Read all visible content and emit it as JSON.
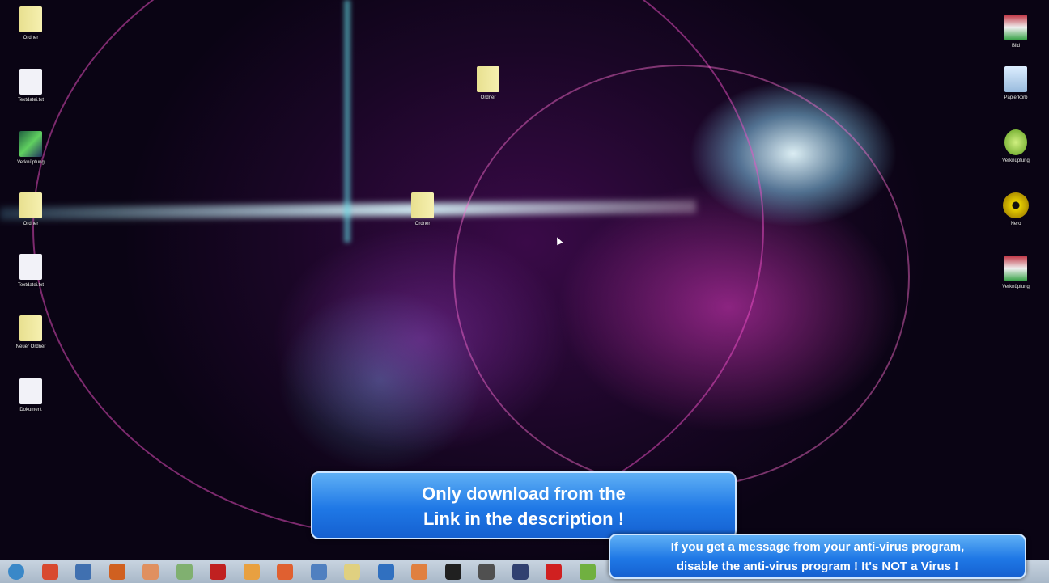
{
  "desktop": {
    "left_icons": [
      {
        "type": "folder",
        "label": "Ordner"
      },
      {
        "type": "doc",
        "label": "Textdatei.txt"
      },
      {
        "type": "net",
        "label": "Verknüpfung"
      },
      {
        "type": "folder",
        "label": "Ordner"
      },
      {
        "type": "doc",
        "label": "Textdatei.txt"
      },
      {
        "type": "folder",
        "label": "Neuer Ordner"
      },
      {
        "type": "doc",
        "label": "Dokument"
      }
    ],
    "center_icons": [
      {
        "type": "folder",
        "label": "Ordner"
      },
      {
        "type": "folder",
        "label": "Ordner"
      }
    ],
    "right_icons": [
      {
        "type": "img",
        "label": "Bild"
      },
      {
        "type": "bin",
        "label": "Papierkorb"
      },
      {
        "type": "globe",
        "label": "Verknüpfung"
      },
      {
        "type": "disc",
        "label": "Nero"
      },
      {
        "type": "img",
        "label": "Verknüpfung"
      }
    ]
  },
  "taskbar": {
    "items": [
      {
        "name": "start-button",
        "color": "#3a88c8"
      },
      {
        "name": "chrome",
        "color": "#d84a30"
      },
      {
        "name": "app",
        "color": "#4070b0"
      },
      {
        "name": "firefox",
        "color": "#d06020"
      },
      {
        "name": "app",
        "color": "#e09060"
      },
      {
        "name": "app",
        "color": "#80b070"
      },
      {
        "name": "filezilla",
        "color": "#c02020"
      },
      {
        "name": "app",
        "color": "#e8a040"
      },
      {
        "name": "app",
        "color": "#e06030"
      },
      {
        "name": "app",
        "color": "#5080c0"
      },
      {
        "name": "app",
        "color": "#e0d080"
      },
      {
        "name": "app",
        "color": "#3070c0"
      },
      {
        "name": "app",
        "color": "#e08040"
      },
      {
        "name": "app",
        "color": "#202020"
      },
      {
        "name": "app",
        "color": "#505050"
      },
      {
        "name": "app",
        "color": "#304070"
      },
      {
        "name": "app",
        "color": "#d02020"
      },
      {
        "name": "app",
        "color": "#70b040"
      }
    ]
  },
  "banners": {
    "main_line1": "Only download from the",
    "main_line2": "Link in the description !",
    "notice_line1": "If you get a message from your anti-virus program,",
    "notice_line2": "disable the anti-virus program ! It's NOT a Virus !"
  }
}
